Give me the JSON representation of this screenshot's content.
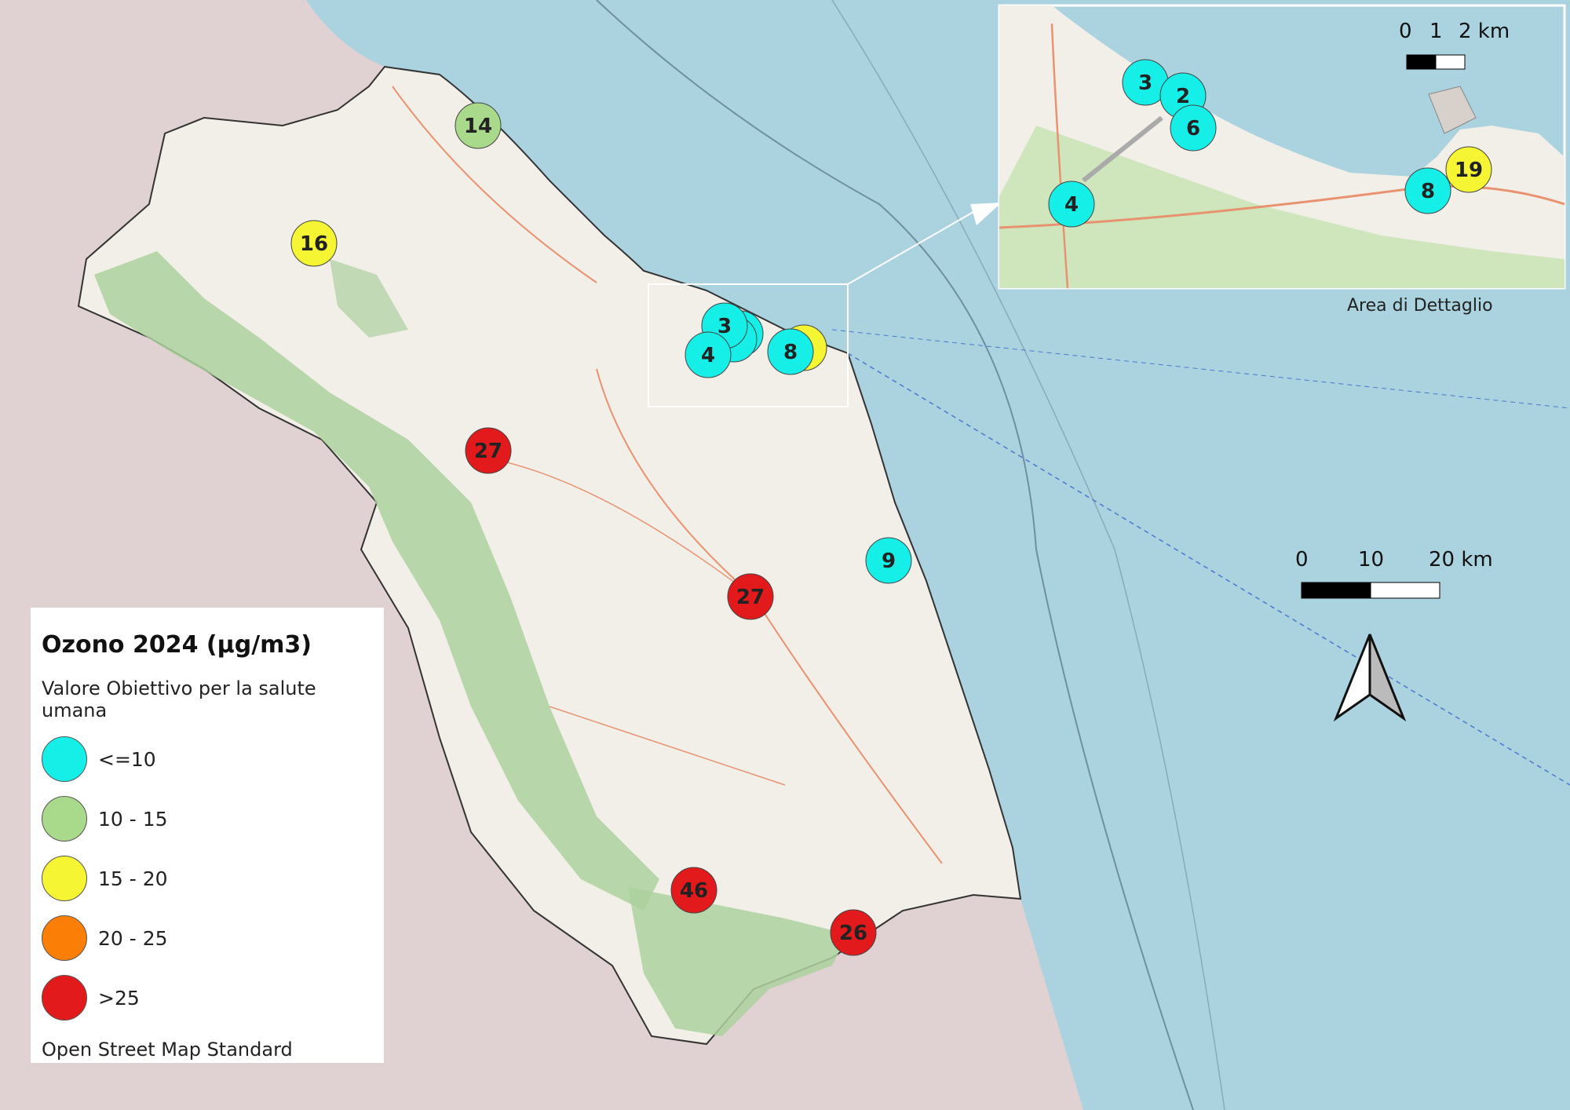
{
  "legend": {
    "title": "Ozono 2024 (µg/m3)",
    "subtitle": "Valore Obiettivo per la salute umana",
    "classes": [
      {
        "label": "<=10",
        "color": "#15efe7"
      },
      {
        "label": "10 - 15",
        "color": "#a9d98a"
      },
      {
        "label": "15 - 20",
        "color": "#f5f534"
      },
      {
        "label": "20 - 25",
        "color": "#fb7f06"
      },
      {
        "label": ">25",
        "color": "#e31a1c"
      }
    ],
    "source": "Open Street Map Standard"
  },
  "inset": {
    "caption": "Area di Dettaglio",
    "scale_labels": [
      "0",
      "1",
      "2 km"
    ],
    "stations": [
      {
        "value": "3",
        "class": 0
      },
      {
        "value": "2",
        "class": 0
      },
      {
        "value": "6",
        "class": 0
      },
      {
        "value": "4",
        "class": 0
      },
      {
        "value": "8",
        "class": 0
      },
      {
        "value": "19",
        "class": 2
      }
    ]
  },
  "main_scale_labels": [
    "0",
    "10",
    "20 km"
  ],
  "stations": [
    {
      "value": "14",
      "class": 1
    },
    {
      "value": "16",
      "class": 2
    },
    {
      "value": "3",
      "class": 0
    },
    {
      "value": "4",
      "class": 0
    },
    {
      "value": "8",
      "class": 0
    },
    {
      "value": "27",
      "class": 4
    },
    {
      "value": "9",
      "class": 0
    },
    {
      "value": "27",
      "class": 4
    },
    {
      "value": "46",
      "class": 4
    },
    {
      "value": "26",
      "class": 4
    }
  ],
  "map_colors": {
    "sea": "#aad3df",
    "land": "#f2efe9",
    "outside": "#e0d1d3",
    "forest": "#add19e"
  }
}
